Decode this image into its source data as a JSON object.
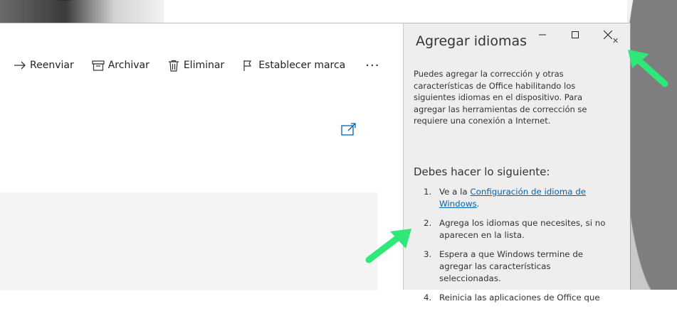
{
  "toolbar": {
    "forward_label": "Reenviar",
    "archive_label": "Archivar",
    "delete_label": "Eliminar",
    "flag_label": "Establecer marca",
    "more_label": "···"
  },
  "dialog": {
    "title": "Agregar idiomas",
    "description": "Puedes agregar la corrección y otras características de Office habilitando los siguientes idiomas en el dispositivo. Para agregar las herramientas de corrección se requiere una conexión a Internet.",
    "subtitle": "Debes hacer lo siguiente:",
    "steps": [
      {
        "num": "1.",
        "prefix": "Ve a la ",
        "link": "Configuración de idioma de Windows",
        "suffix": "."
      },
      {
        "num": "2.",
        "text": "Agrega los idiomas que necesites, si no aparecen en la lista."
      },
      {
        "num": "3.",
        "text": "Espera a que Windows termine de agregar las características seleccionadas."
      },
      {
        "num": "4.",
        "text": "Reinicia las aplicaciones de Office que"
      }
    ]
  },
  "colors": {
    "accent": "#0063b1",
    "annotation_arrow": "#2ee87a",
    "dialog_bg": "#eeeeee",
    "reading_pane_bg": "#f4f4f4"
  },
  "icons": {
    "forward": "arrow-right-icon",
    "archive": "archive-box-icon",
    "delete": "trash-icon",
    "flag": "flag-icon",
    "popout": "open-in-new-window-icon"
  }
}
